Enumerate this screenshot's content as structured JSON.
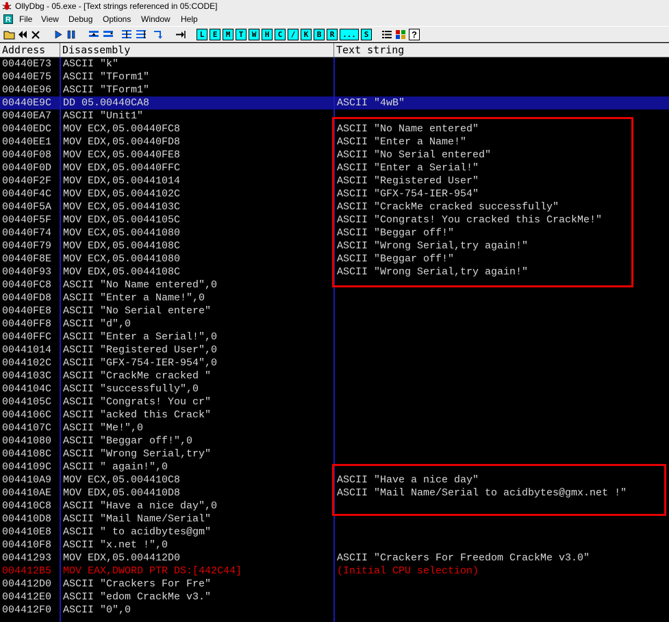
{
  "window": {
    "title": "OllyDbg - 05.exe - [Text strings referenced in 05:CODE]"
  },
  "menu": [
    "File",
    "View",
    "Debug",
    "Options",
    "Window",
    "Help"
  ],
  "toolbar": {
    "letters": [
      "L",
      "E",
      "M",
      "T",
      "W",
      "H",
      "C",
      "/",
      "K",
      "B",
      "R",
      "...",
      "S"
    ]
  },
  "columns": {
    "address": "Address",
    "disassembly": "Disassembly",
    "text": "Text string"
  },
  "rows": [
    {
      "address": "00440E73",
      "disasm": "ASCII \"k\"",
      "text": ""
    },
    {
      "address": "00440E75",
      "disasm": "ASCII \"TForm1\"",
      "text": ""
    },
    {
      "address": "00440E96",
      "disasm": "ASCII \"TForm1\"",
      "text": ""
    },
    {
      "address": "00440E9C",
      "disasm": "DD 05.00440CA8",
      "text": "ASCII \"4wB\""
    },
    {
      "address": "00440EA7",
      "disasm": "ASCII \"Unit1\"",
      "text": ""
    },
    {
      "address": "00440EDC",
      "disasm": "MOV ECX,05.00440FC8",
      "text": "ASCII \"No Name entered\""
    },
    {
      "address": "00440EE1",
      "disasm": "MOV EDX,05.00440FD8",
      "text": "ASCII \"Enter a Name!\""
    },
    {
      "address": "00440F08",
      "disasm": "MOV ECX,05.00440FE8",
      "text": "ASCII \"No Serial entered\""
    },
    {
      "address": "00440F0D",
      "disasm": "MOV EDX,05.00440FFC",
      "text": "ASCII \"Enter a Serial!\""
    },
    {
      "address": "00440F2F",
      "disasm": "MOV EDX,05.00441014",
      "text": "ASCII \"Registered User\""
    },
    {
      "address": "00440F4C",
      "disasm": "MOV EDX,05.0044102C",
      "text": "ASCII \"GFX-754-IER-954\""
    },
    {
      "address": "00440F5A",
      "disasm": "MOV ECX,05.0044103C",
      "text": "ASCII \"CrackMe cracked successfully\""
    },
    {
      "address": "00440F5F",
      "disasm": "MOV EDX,05.0044105C",
      "text": "ASCII \"Congrats! You cracked this CrackMe!\""
    },
    {
      "address": "00440F74",
      "disasm": "MOV ECX,05.00441080",
      "text": "ASCII \"Beggar off!\""
    },
    {
      "address": "00440F79",
      "disasm": "MOV EDX,05.0044108C",
      "text": "ASCII \"Wrong Serial,try again!\""
    },
    {
      "address": "00440F8E",
      "disasm": "MOV ECX,05.00441080",
      "text": "ASCII \"Beggar off!\""
    },
    {
      "address": "00440F93",
      "disasm": "MOV EDX,05.0044108C",
      "text": "ASCII \"Wrong Serial,try again!\""
    },
    {
      "address": "00440FC8",
      "disasm": "ASCII \"No Name entered\",0",
      "text": ""
    },
    {
      "address": "00440FD8",
      "disasm": "ASCII \"Enter a Name!\",0",
      "text": ""
    },
    {
      "address": "00440FE8",
      "disasm": "ASCII \"No Serial entere\"",
      "text": ""
    },
    {
      "address": "00440FF8",
      "disasm": "ASCII \"d\",0",
      "text": ""
    },
    {
      "address": "00440FFC",
      "disasm": "ASCII \"Enter a Serial!\",0",
      "text": ""
    },
    {
      "address": "00441014",
      "disasm": "ASCII \"Registered User\",0",
      "text": ""
    },
    {
      "address": "0044102C",
      "disasm": "ASCII \"GFX-754-IER-954\",0",
      "text": ""
    },
    {
      "address": "0044103C",
      "disasm": "ASCII \"CrackMe cracked \"",
      "text": ""
    },
    {
      "address": "0044104C",
      "disasm": "ASCII \"successfully\",0",
      "text": ""
    },
    {
      "address": "0044105C",
      "disasm": "ASCII \"Congrats! You cr\"",
      "text": ""
    },
    {
      "address": "0044106C",
      "disasm": "ASCII \"acked this Crack\"",
      "text": ""
    },
    {
      "address": "0044107C",
      "disasm": "ASCII \"Me!\",0",
      "text": ""
    },
    {
      "address": "00441080",
      "disasm": "ASCII \"Beggar off!\",0",
      "text": ""
    },
    {
      "address": "0044108C",
      "disasm": "ASCII \"Wrong Serial,try\"",
      "text": ""
    },
    {
      "address": "0044109C",
      "disasm": "ASCII \" again!\",0",
      "text": ""
    },
    {
      "address": "004410A9",
      "disasm": "MOV ECX,05.004410C8",
      "text": "ASCII \"Have a nice day\""
    },
    {
      "address": "004410AE",
      "disasm": "MOV EDX,05.004410D8",
      "text": "ASCII \"Mail Name/Serial to acidbytes@gmx.net !\""
    },
    {
      "address": "004410C8",
      "disasm": "ASCII \"Have a nice day\",0",
      "text": ""
    },
    {
      "address": "004410D8",
      "disasm": "ASCII \"Mail Name/Serial\"",
      "text": ""
    },
    {
      "address": "004410E8",
      "disasm": "ASCII \" to acidbytes@gm\"",
      "text": ""
    },
    {
      "address": "004410F8",
      "disasm": "ASCII \"x.net !\",0",
      "text": ""
    },
    {
      "address": "00441293",
      "disasm": "MOV EDX,05.004412D0",
      "text": "ASCII \"Crackers For Freedom CrackMe v3.0\""
    },
    {
      "address": "004412B5",
      "disasm": "MOV EAX,DWORD PTR DS:[442C44]",
      "text": "(Initial CPU selection)"
    },
    {
      "address": "004412D0",
      "disasm": "ASCII \"Crackers For Fre\"",
      "text": ""
    },
    {
      "address": "004412E0",
      "disasm": "ASCII \"edom CrackMe v3.\"",
      "text": ""
    },
    {
      "address": "004412F0",
      "disasm": "ASCII \"0\",0",
      "text": ""
    }
  ],
  "selected_row": 3,
  "initial_cpu_row": 39,
  "colors": {
    "selection": "#101090",
    "annotation": "#e60000",
    "initial_cpu": "#e00000"
  }
}
